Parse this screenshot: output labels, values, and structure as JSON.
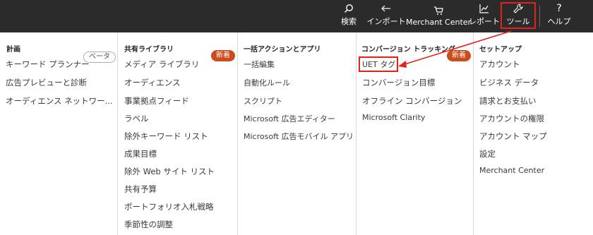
{
  "topbar": {
    "search": {
      "label": "検索",
      "icon": "search-icon"
    },
    "import": {
      "label": "インポート",
      "icon": "import-arrow-icon"
    },
    "merchant": {
      "label": "Merchant Center",
      "icon": "cart-icon"
    },
    "report": {
      "label": "レポート",
      "icon": "chart-icon"
    },
    "tools": {
      "label": "ツール",
      "icon": "wrench-icon"
    },
    "help": {
      "label": "ヘルプ",
      "icon": "question-icon"
    }
  },
  "menu": {
    "plan": {
      "title": "計画",
      "items": [
        "キーワード プランナー",
        "広告プレビューと診断",
        "オーディエンス ネットワー..."
      ],
      "beta_badge": "ベータ"
    },
    "shared_library": {
      "title": "共有ライブラリ",
      "new_badge": "新着",
      "items": [
        "メディア ライブラリ",
        "オーディエンス",
        "事業拠点フィード",
        "ラベル",
        "除外キーワード リスト",
        "成果目標",
        "除外 Web サイト リスト",
        "共有予算",
        "ポートフォリオ入札戦略",
        "季節性の調整"
      ]
    },
    "bulk_actions": {
      "title": "一括アクションとアプリ",
      "items": [
        "一括編集",
        "自動化ルール",
        "スクリプト",
        "Microsoft 広告エディター",
        "Microsoft 広告モバイル アプリ"
      ]
    },
    "conversion_tracking": {
      "title": "コンバージョン トラッキング",
      "new_badge": "新着",
      "items": [
        "UET タグ",
        "コンバージョン目標",
        "オフライン コンバージョン",
        "Microsoft Clarity"
      ]
    },
    "setup": {
      "title": "セットアップ",
      "items": [
        "アカウント",
        "ビジネス データ",
        "請求とお支払い",
        "アカウントの権限",
        "アカウント マップ",
        "設定",
        "Merchant Center"
      ]
    }
  },
  "colors": {
    "topbar_bg": "#2b2b2b",
    "annotation_red": "#e8201a",
    "new_badge": "#cc4b1c"
  }
}
